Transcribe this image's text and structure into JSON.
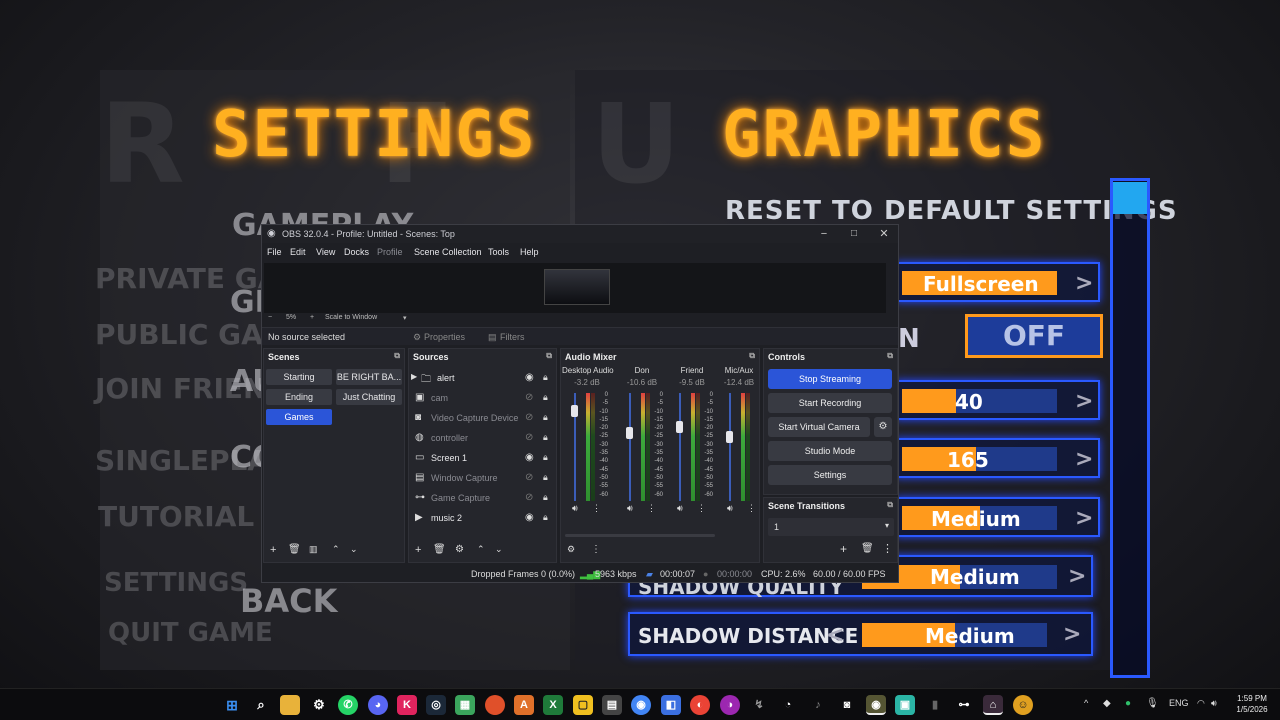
{
  "game": {
    "left_title": "SETTINGS",
    "right_title": "GRAPHICS",
    "left_menu": [
      "GAMEPLAY",
      "PRIVATE GAME",
      "GR",
      "PUBLIC GAME",
      "JOIN FRIEND",
      "AU",
      "SINGLEPLAY",
      "CO",
      "TUTORIAL",
      "SETTINGS",
      "QUIT GAME",
      "BACK"
    ],
    "reset_label": "RESET TO DEFAULT SETTINGS",
    "options": [
      {
        "label": "",
        "value": "Fullscreen",
        "fill": 1.0
      },
      {
        "label": "N",
        "value": "OFF",
        "fill": 0
      },
      {
        "label": "",
        "value": "40",
        "fill": 0.35
      },
      {
        "label": "",
        "value": "165",
        "fill": 0.5
      },
      {
        "label": "",
        "value": "Medium",
        "fill": 0.5
      },
      {
        "label": "SHADOW QUALITY",
        "value": "Medium",
        "fill": 0.5
      },
      {
        "label": "SHADOW DISTANCE",
        "value": "Medium",
        "fill": 0.5
      }
    ],
    "arrow_left": "<",
    "arrow_right": ">"
  },
  "obs": {
    "title": "OBS 32.0.4 - Profile: Untitled - Scenes: Top",
    "menu": [
      "File",
      "Edit",
      "View",
      "Docks",
      "Profile",
      "Scene Collection",
      "Tools",
      "Help"
    ],
    "zoom": {
      "minus": "−",
      "value": "5%",
      "plus": "+",
      "mode": "Scale to Window"
    },
    "source_bar": {
      "selected": "No source selected",
      "properties": "Properties",
      "filters": "Filters"
    },
    "scenes": {
      "title": "Scenes",
      "items": [
        "Starting",
        "BE RIGHT BA...",
        "Ending",
        "Just Chatting",
        "Games"
      ],
      "active": "Games"
    },
    "sources": {
      "title": "Sources",
      "items": [
        {
          "name": "alert",
          "icon": "folder-icon",
          "visible": true
        },
        {
          "name": "cam",
          "icon": "image-icon",
          "visible": false
        },
        {
          "name": "Video Capture Device",
          "icon": "camera-icon",
          "visible": false
        },
        {
          "name": "controller",
          "icon": "browser-icon",
          "visible": false
        },
        {
          "name": "Screen 1",
          "icon": "monitor-icon",
          "visible": true
        },
        {
          "name": "Window Capture",
          "icon": "window-icon",
          "visible": false
        },
        {
          "name": "Game Capture",
          "icon": "gamepad-icon",
          "visible": false
        },
        {
          "name": "music 2",
          "icon": "play-icon",
          "visible": true
        }
      ]
    },
    "mixer": {
      "title": "Audio Mixer",
      "channels": [
        {
          "name": "Desktop Audio",
          "db": "-3.2 dB",
          "level": 0.78
        },
        {
          "name": "Don",
          "db": "-10.6 dB",
          "level": 0.6
        },
        {
          "name": "Friend",
          "db": "-9.5 dB",
          "level": 0.62
        },
        {
          "name": "Mic/Aux",
          "db": "-12.4 dB",
          "level": 0.57
        }
      ],
      "scale": [
        "0",
        "-5",
        "-10",
        "-15",
        "-20",
        "-25",
        "-30",
        "-35",
        "-40",
        "-45",
        "-50",
        "-55",
        "-60"
      ]
    },
    "controls": {
      "title": "Controls",
      "stop_streaming": "Stop Streaming",
      "start_recording": "Start Recording",
      "start_virtual_camera": "Start Virtual Camera",
      "studio_mode": "Studio Mode",
      "settings": "Settings"
    },
    "transitions": {
      "title": "Scene Transitions",
      "value": "1"
    },
    "status": {
      "dropped": "Dropped Frames 0 (0.0%)",
      "bitrate": "5963 kbps",
      "stream_time": "00:00:07",
      "rec_time": "00:00:00",
      "cpu": "CPU: 2.6%",
      "fps": "60.00 / 60.00 FPS"
    }
  },
  "taskbar": {
    "lang": "ENG",
    "time": "1:59 PM",
    "date": "1/5/2026",
    "chevron": "^"
  },
  "colors": {
    "accent_orange": "#ffb020",
    "obs_blue": "#2b55d8",
    "game_blue": "#2a59ff"
  }
}
